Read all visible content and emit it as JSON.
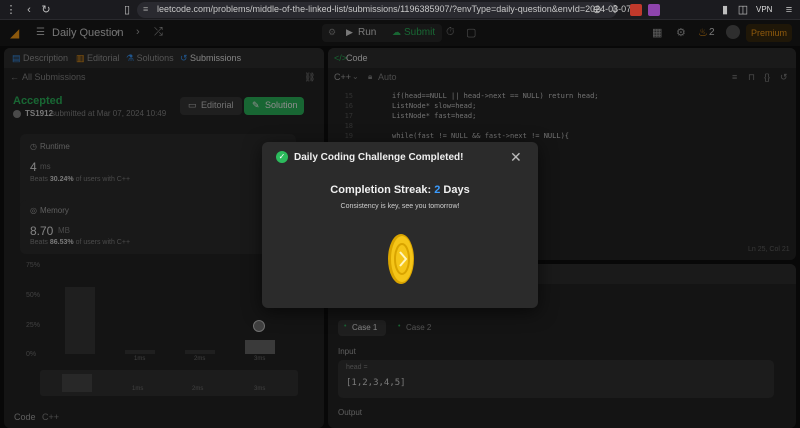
{
  "browser": {
    "url": "leetcode.com/problems/middle-of-the-linked-list/submissions/1196385907/?envType=daily-question&envId=2024-03-07",
    "vpn_label": "VPN"
  },
  "topbar": {
    "title": "Daily Question",
    "run_label": "Run",
    "submit_label": "Submit",
    "streak_count": "2",
    "premium_label": "Premium"
  },
  "left": {
    "tabs": [
      "Description",
      "Editorial",
      "Solutions",
      "Submissions"
    ],
    "back_label": "All Submissions",
    "status": "Accepted",
    "user": "TS1912",
    "submitted": "submitted at Mar 07, 2024 10:49",
    "editorial_btn": "Editorial",
    "solution_btn": "Solution",
    "runtime_label": "Runtime",
    "runtime_value": "4",
    "runtime_unit": "ms",
    "runtime_beats_prefix": "Beats",
    "runtime_beats": "30.24%",
    "runtime_beats_suffix": "of users with C++",
    "memory_label": "Memory",
    "memory_value": "8.70",
    "memory_unit": "MB",
    "memory_beats_prefix": "Beats",
    "memory_beats": "86.53%",
    "memory_beats_suffix": "of users with C++",
    "axis_ticks": [
      "75%",
      "50%",
      "25%",
      "0%"
    ],
    "x_ticks": [
      "1ms",
      "2ms",
      "3ms"
    ],
    "mini_ticks": [
      "1ms",
      "2ms",
      "3ms"
    ],
    "code_label": "Code",
    "lang_label": "C++"
  },
  "code": {
    "header": "Code",
    "lang": "C++",
    "auto": "Auto",
    "lines": [
      {
        "n": "15",
        "t": "if(head==NULL || head->next == NULL) return head;"
      },
      {
        "n": "16",
        "t": "ListNode* slow=head;"
      },
      {
        "n": "17",
        "t": "ListNode* fast=head;"
      },
      {
        "n": "18",
        "t": ""
      },
      {
        "n": "19",
        "t": "while(fast != NULL && fast->next != NULL){"
      }
    ],
    "cursor": "Ln 25, Col 21"
  },
  "testcase": {
    "case1": "Case 1",
    "case2": "Case 2",
    "input_label": "Input",
    "param": "head =",
    "value": "[1,2,3,4,5]",
    "output_label": "Output"
  },
  "modal": {
    "title": "Daily Coding Challenge Completed!",
    "streak_prefix": "Completion Streak:",
    "streak_number": "2",
    "streak_suffix": "Days",
    "message": "Consistency is key, see you tomorrow!"
  },
  "colors": {
    "accent_green": "#2cbb5d",
    "accent_blue": "#3b9cff",
    "coin_gold": "#f5c518",
    "premium": "#ffa116"
  }
}
